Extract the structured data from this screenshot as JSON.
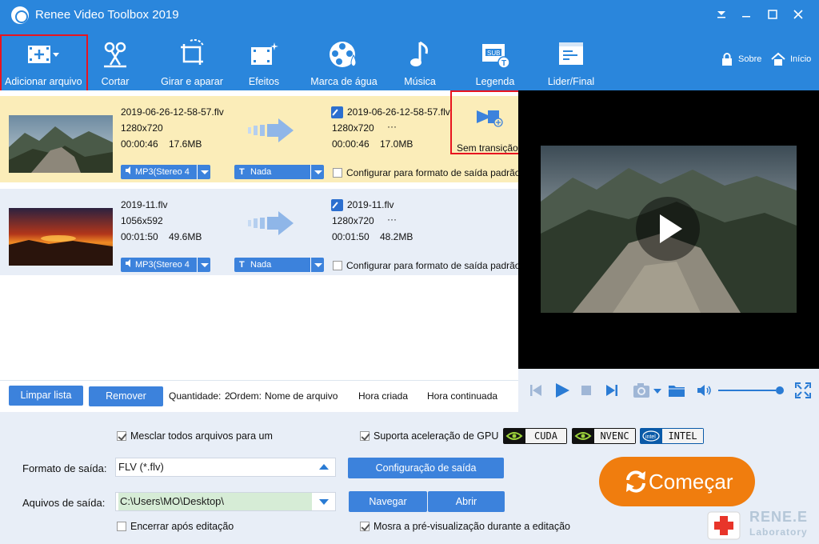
{
  "app": {
    "title": "Renee Video Toolbox 2019"
  },
  "toolbar": {
    "items": [
      {
        "label": "Adicionar arquivo",
        "icon": "add-file-icon"
      },
      {
        "label": "Cortar",
        "icon": "scissors-icon"
      },
      {
        "label": "Girar e aparar",
        "icon": "crop-rotate-icon"
      },
      {
        "label": "Efeitos",
        "icon": "effects-film-icon"
      },
      {
        "label": "Marca de água",
        "icon": "watermark-icon"
      },
      {
        "label": "Música",
        "icon": "music-note-icon"
      },
      {
        "label": "Legenda",
        "icon": "subtitle-icon"
      },
      {
        "label": "Lider/Final",
        "icon": "intro-outro-icon"
      }
    ],
    "about_label": "Sobre",
    "home_label": "Início"
  },
  "files": [
    {
      "src_name": "2019-06-26-12-58-57.flv",
      "src_res": "1280x720",
      "src_duration": "00:00:46",
      "src_size": "17.6MB",
      "out_name": "2019-06-26-12-58-57.flv",
      "out_res": "1280x720",
      "out_more": "···",
      "out_duration": "00:00:46",
      "out_size": "17.0MB",
      "audio": "MP3(Stereo 4",
      "subtitle": "Nada",
      "config_label": "Configurar para formato de saída padrão",
      "transition_label": "Sem transição"
    },
    {
      "src_name": "2019-11.flv",
      "src_res": "1056x592",
      "src_duration": "00:01:50",
      "src_size": "49.6MB",
      "out_name": "2019-11.flv",
      "out_res": "1280x720",
      "out_more": "···",
      "out_duration": "00:01:50",
      "out_size": "48.2MB",
      "audio": "MP3(Stereo 4",
      "subtitle": "Nada",
      "config_label": "Configurar para formato de saída padrão"
    }
  ],
  "list_footer": {
    "clear_label": "Limpar lista",
    "remove_label": "Remover",
    "quantity_label": "Quantidade:",
    "quantity_value": "2",
    "order_label": "Ordem:",
    "sort_name": "Nome de arquivo",
    "sort_created": "Hora criada",
    "sort_duration": "Hora continuada"
  },
  "player": {
    "volume": 0.95
  },
  "settings": {
    "merge_label": "Mesclar todos arquivos para um",
    "merge_checked": true,
    "gpu_label": "Suporta aceleração de GPU",
    "gpu_checked": true,
    "gpu_options": [
      "CUDA",
      "NVENC",
      "INTEL"
    ],
    "format_label": "Formato de saída:",
    "format_value": "FLV (*.flv)",
    "output_config_label": "Configuração de saída",
    "output_folder_label": "Aquivos de saída:",
    "output_folder_value": "C:\\Users\\MO\\Desktop\\",
    "browse_label": "Navegar",
    "open_label": "Abrir",
    "shutdown_label": "Encerrar após editação",
    "shutdown_checked": false,
    "preview_label": "Mosra a pré-visualização durante a editação",
    "preview_checked": true,
    "start_label": "Começar"
  },
  "brand": {
    "line1": "RENE.E",
    "line2": "Laboratory"
  },
  "colors": {
    "primary": "#2a86dc",
    "selected_row": "#fbedb9",
    "start": "#f07d0e",
    "highlight": "#e8141f"
  }
}
